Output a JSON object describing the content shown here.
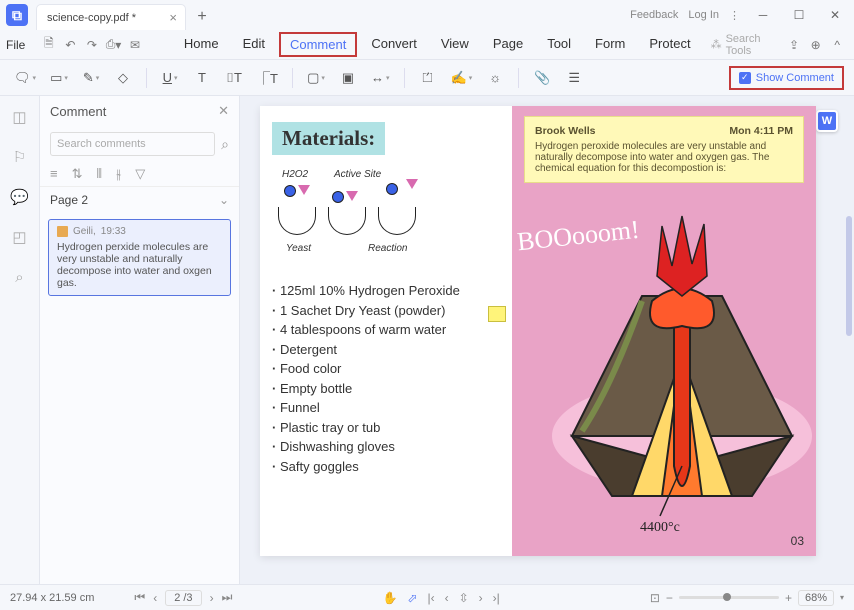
{
  "title": {
    "tab": "science-copy.pdf *",
    "feedback": "Feedback",
    "login": "Log In"
  },
  "menu": {
    "file": "File",
    "items": [
      "Home",
      "Edit",
      "Comment",
      "Convert",
      "View",
      "Page",
      "Tool",
      "Form",
      "Protect"
    ],
    "search": "Search Tools"
  },
  "toolbar": {
    "showComment": "Show Comment"
  },
  "comments": {
    "title": "Comment",
    "searchPlaceholder": "Search comments",
    "pageLabel": "Page 2",
    "card": {
      "author": "Geili,",
      "time": "19:33",
      "text": "Hydrogen perxide molecules are very unstable and naturally decompose into water and oxgen gas."
    }
  },
  "doc": {
    "materialsTitle": "Materials:",
    "labels": {
      "h2o2": "H2O2",
      "active": "Active Site",
      "yeast": "Yeast",
      "reaction": "Reaction"
    },
    "list": [
      "125ml 10% Hydrogen Peroxide",
      "1 Sachet Dry Yeast (powder)",
      "4 tablespoons of warm water",
      "Detergent",
      "Food color",
      "Empty bottle",
      "Funnel",
      "Plastic tray or tub",
      "Dishwashing gloves",
      "Safty goggles"
    ],
    "sticky": {
      "author": "Brook Wells",
      "time": "Mon 4:11 PM",
      "body": "Hydrogen peroxide molecules are very unstable and naturally decompose into water and oxygen gas. The chemical equation for this decompostion is:"
    },
    "boom": "BOOooom!",
    "temp": "4400°c",
    "pagenum": "03"
  },
  "status": {
    "dims": "27.94 x 21.59 cm",
    "page": "2 /3",
    "zoom": "68%"
  }
}
